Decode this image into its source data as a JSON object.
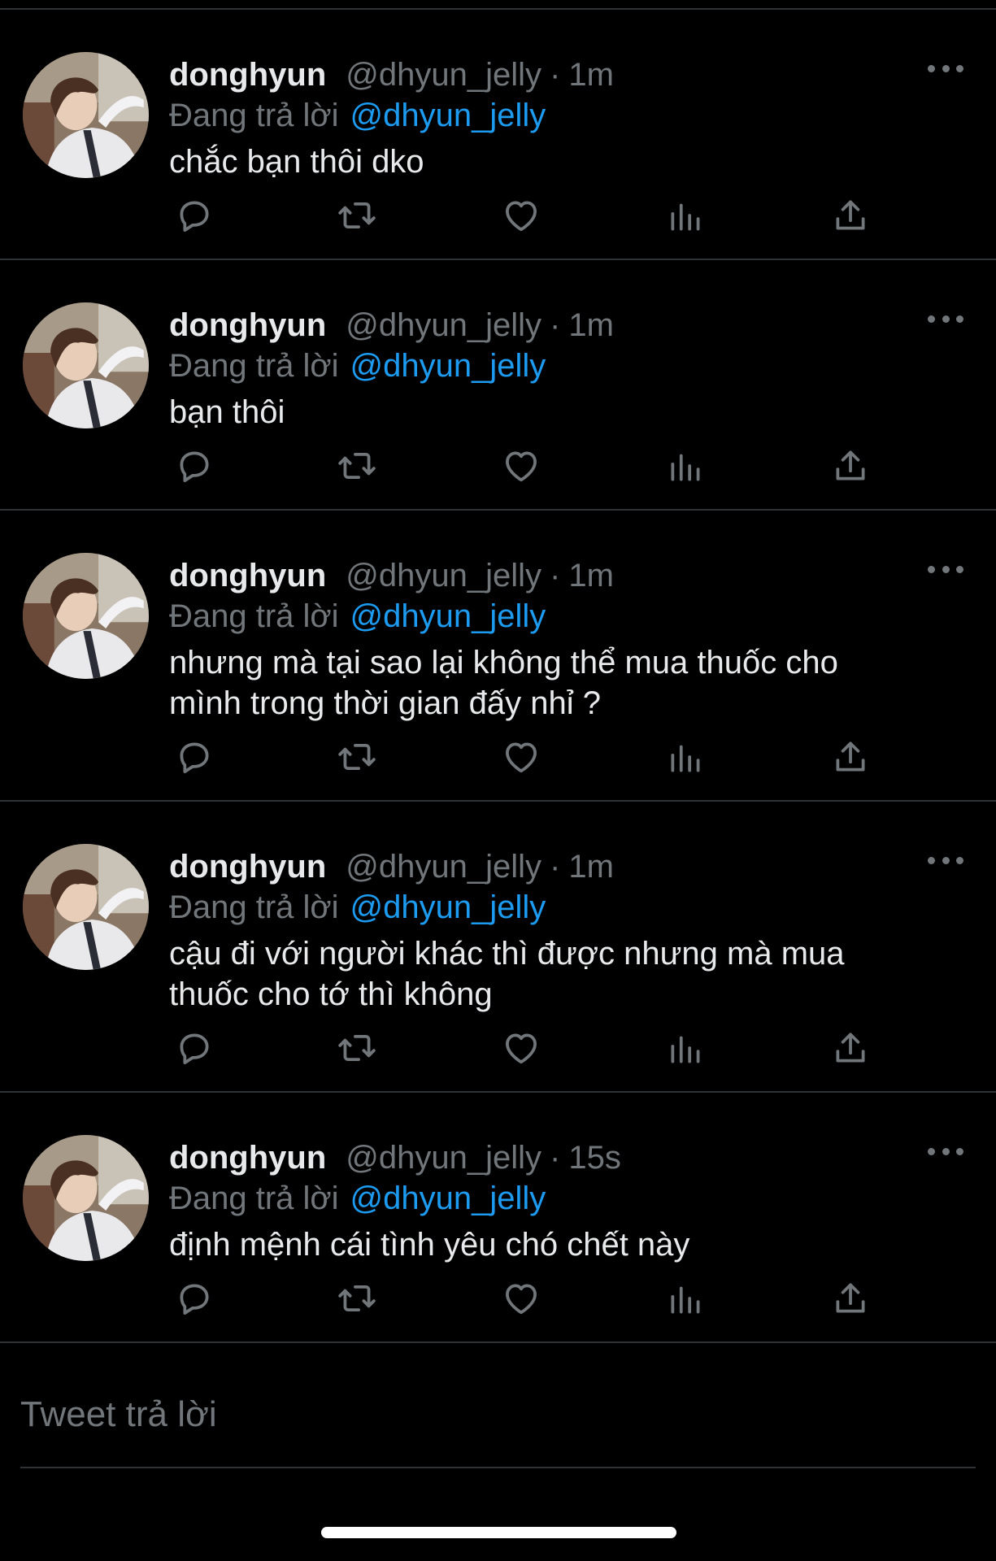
{
  "colors": {
    "background": "#000000",
    "text": "#e7e9ea",
    "muted": "#71767b",
    "accent": "#1d9bf0",
    "divider": "#2f3336"
  },
  "tweets": [
    {
      "name": "donghyun",
      "handle": "@dhyun_jelly",
      "time": "1m",
      "reply_prefix": "Đang trả lời",
      "reply_to": "@dhyun_jelly",
      "text": "chắc bạn thôi dko"
    },
    {
      "name": "donghyun",
      "handle": "@dhyun_jelly",
      "time": "1m",
      "reply_prefix": "Đang trả lời",
      "reply_to": "@dhyun_jelly",
      "text": "bạn thôi"
    },
    {
      "name": "donghyun",
      "handle": "@dhyun_jelly",
      "time": "1m",
      "reply_prefix": "Đang trả lời",
      "reply_to": "@dhyun_jelly",
      "text": "nhưng mà tại sao lại không thể mua thuốc cho\nmình trong thời gian đấy nhỉ ?"
    },
    {
      "name": "donghyun",
      "handle": "@dhyun_jelly",
      "time": "1m",
      "reply_prefix": "Đang trả lời",
      "reply_to": "@dhyun_jelly",
      "text": "cậu đi với người khác thì được nhưng mà mua\nthuốc cho tớ thì không"
    },
    {
      "name": "donghyun",
      "handle": "@dhyun_jelly",
      "time": "15s",
      "reply_prefix": "Đang trả lời",
      "reply_to": "@dhyun_jelly",
      "text": "định mệnh cái tình yêu chó chết này"
    }
  ],
  "actions": [
    "reply-icon",
    "retweet-icon",
    "like-icon",
    "analytics-icon",
    "share-icon"
  ],
  "composer": {
    "placeholder": "Tweet trả lời"
  }
}
